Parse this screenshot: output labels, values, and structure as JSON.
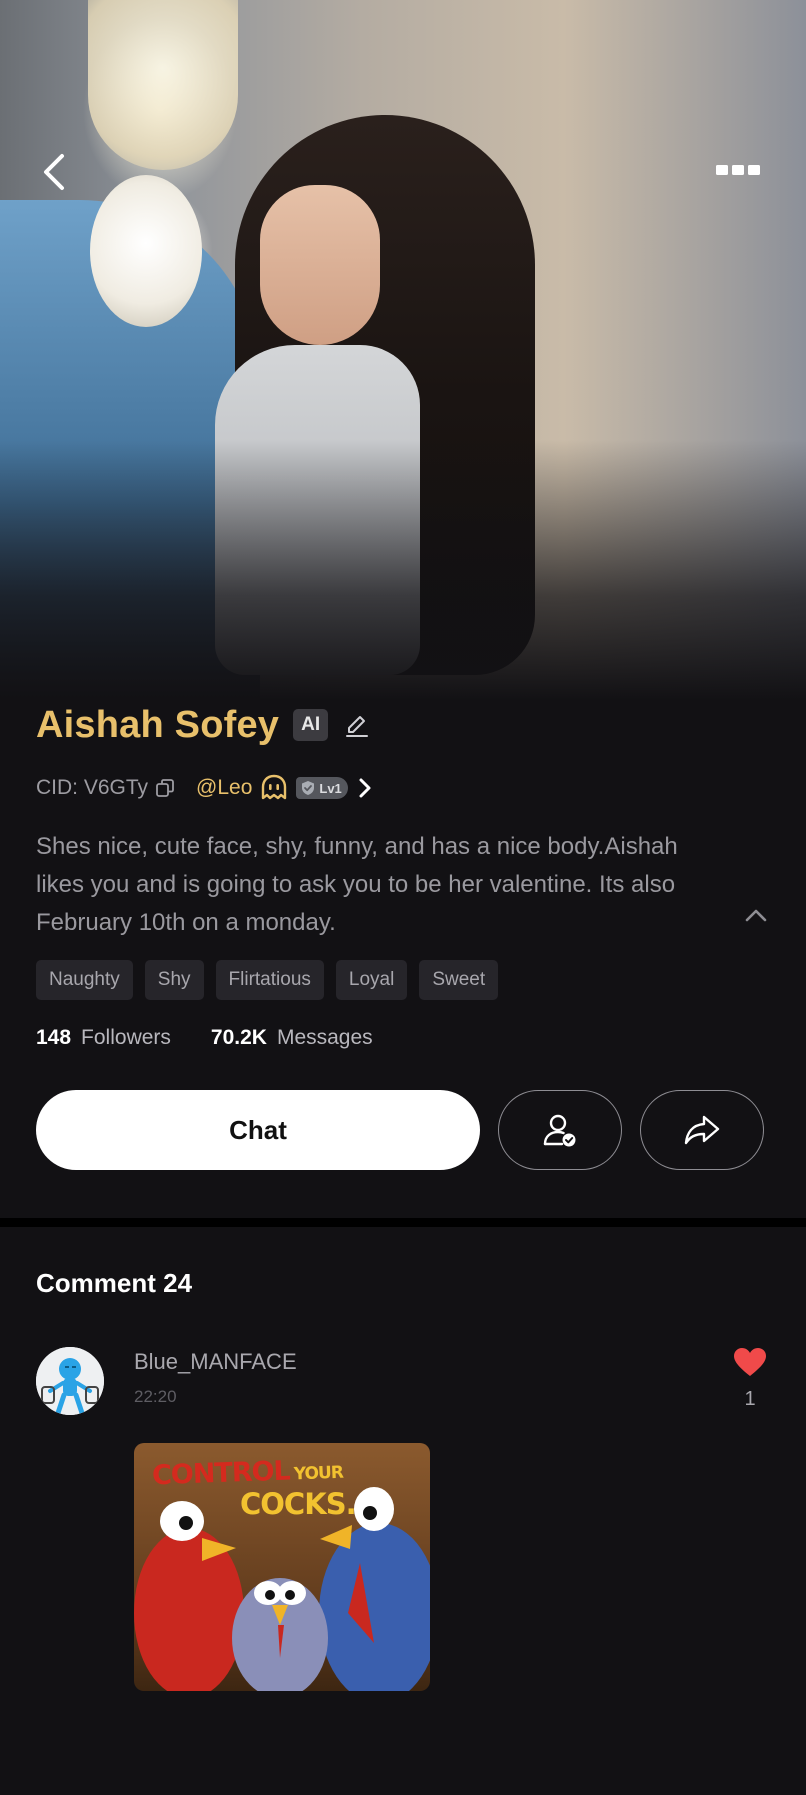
{
  "header": {
    "back_icon": "chevron-left-icon",
    "more_icon": "more-dots-icon"
  },
  "profile": {
    "name": "Aishah Sofey",
    "ai_badge": "AI",
    "cid": "CID: V6GTy",
    "creator": "@Leo",
    "level": "Lv1",
    "bio": "Shes nice, cute face, shy, funny, and has a nice body.Aishah likes you and is going to ask you to be her valentine. Its also February 10th on a monday.",
    "tags": [
      "Naughty",
      "Shy",
      "Flirtatious",
      "Loyal",
      "Sweet"
    ],
    "stats": {
      "followers_count": "148",
      "followers_label": "Followers",
      "messages_count": "70.2K",
      "messages_label": "Messages"
    },
    "chat_label": "Chat"
  },
  "comments": {
    "title": "Comment 24",
    "items": [
      {
        "user": "Blue_MANFACE",
        "time": "22:20",
        "likes": "1",
        "image_text_line1": "CONTROL",
        "image_text_your": "YOUR",
        "image_text_line2": "COCKS."
      }
    ]
  },
  "colors": {
    "accent_gold": "#e8c06b",
    "background": "#121114",
    "heart_red": "#f04a4a"
  }
}
